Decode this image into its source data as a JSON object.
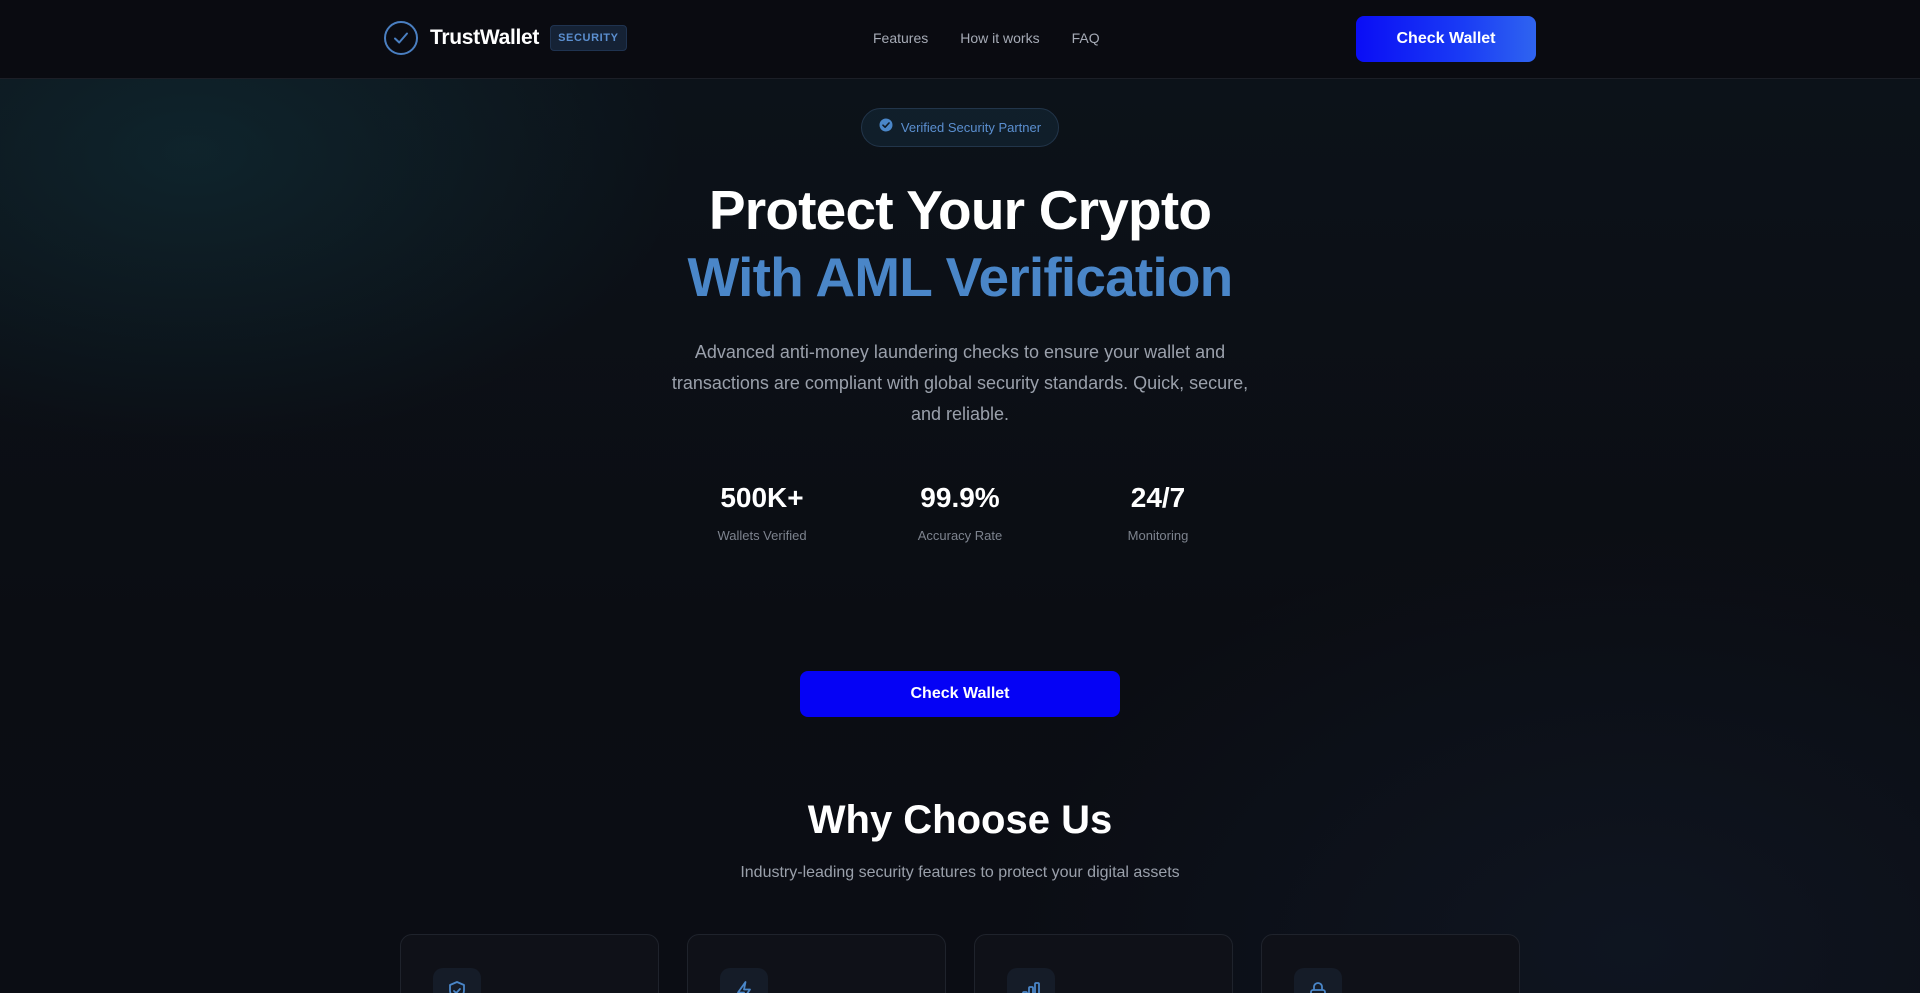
{
  "header": {
    "brand_name": "TrustWallet",
    "brand_badge": "SECURITY",
    "nav": [
      "Features",
      "How it works",
      "FAQ"
    ],
    "cta_label": "Check Wallet"
  },
  "hero": {
    "pill_text": "Verified Security Partner",
    "title_line1": "Protect Your Crypto",
    "title_line2": "With AML Verification",
    "description": "Advanced anti-money laundering checks to ensure your wallet and transactions are compliant with global security standards. Quick, secure, and reliable.",
    "stats": [
      {
        "value": "500K+",
        "label": "Wallets Verified"
      },
      {
        "value": "99.9%",
        "label": "Accuracy Rate"
      },
      {
        "value": "24/7",
        "label": "Monitoring"
      }
    ],
    "cta_label": "Check Wallet"
  },
  "why": {
    "title": "Why Choose Us",
    "subtitle": "Industry-leading security features to protect your digital assets",
    "card_icons": [
      "shield-check-icon",
      "lightning-icon",
      "bar-chart-icon",
      "lock-icon"
    ]
  },
  "colors": {
    "accent": "#4a86c8",
    "primary_button": "#0502f5",
    "background": "#0b0c12"
  }
}
